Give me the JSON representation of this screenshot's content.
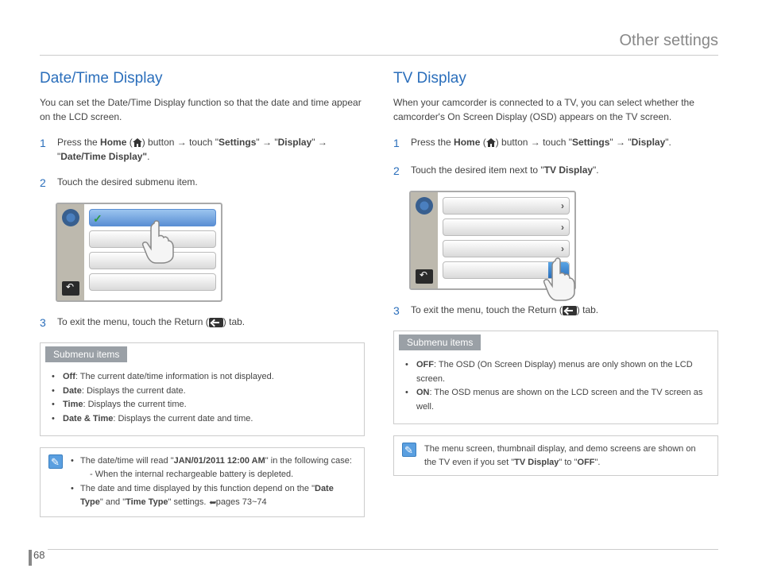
{
  "page_header": "Other settings",
  "page_number": "68",
  "left": {
    "title": "Date/Time Display",
    "intro": "You can set the Date/Time Display function so that the date and time appear on the LCD screen.",
    "step1_a": "Press the ",
    "step1_home": "Home",
    "step1_b": " (",
    "step1_c": ") button ",
    "arrow": "→",
    "step1_touch": " touch \"",
    "step1_settings": "Settings",
    "step1_q2": "\" ",
    "step1_q3": " \"",
    "step1_display": "Display",
    "step1_q4": "\" ",
    "step1_q5": " \"",
    "step1_dtd": "Date/Time Display\"",
    "step1_period": ".",
    "step2": "Touch the desired submenu item.",
    "step3_a": "To exit the menu, touch the Return (",
    "step3_b": ") tab.",
    "submenu_header": "Submenu items",
    "submenu": [
      {
        "label": "Off",
        "desc": ": The current date/time information is not displayed."
      },
      {
        "label": "Date",
        "desc": ": Displays the current date."
      },
      {
        "label": "Time",
        "desc": ": Displays the current time."
      },
      {
        "label": "Date & Time",
        "desc": ": Displays the current date and time."
      }
    ],
    "note1_a": "The date/time will read \"",
    "note1_bold": "JAN/01/2011 12:00 AM",
    "note1_b": "\" in the following case:",
    "note1_sub": "- When the internal rechargeable battery is depleted.",
    "note2_a": "The date and time displayed by this function depend on the \"",
    "note2_dt": "Date Type",
    "note2_b": "\" and \"",
    "note2_tt": "Time Type",
    "note2_c": "\" settings. ",
    "note2_pages": "pages 73~74"
  },
  "right": {
    "title": "TV Display",
    "intro": "When your camcorder is connected to a TV, you can select whether the camcorder's On Screen Display (OSD) appears on the TV screen.",
    "step1_a": "Press the ",
    "step1_home": "Home",
    "step1_b": " (",
    "step1_c": ") button ",
    "step1_touch": " touch \"",
    "step1_settings": "Settings",
    "step1_q2": "\" ",
    "step1_q3": " \"",
    "step1_display": "Display",
    "step1_q4": "\".",
    "step2_a": "Touch the desired item next to \"",
    "step2_bold": "TV Display",
    "step2_b": "\".",
    "step3_a": "To exit the menu, touch the Return (",
    "step3_b": ") tab.",
    "submenu_header": "Submenu items",
    "submenu": [
      {
        "label": "OFF",
        "desc": ": The OSD (On Screen Display) menus are only shown on the LCD screen."
      },
      {
        "label": "ON",
        "desc": ": The OSD menus are shown on the LCD screen and the TV screen as well."
      }
    ],
    "note_a": "The menu screen, thumbnail display, and demo screens are shown on the TV even if you set \"",
    "note_bold1": "TV Display",
    "note_b": "\" to \"",
    "note_bold2": "OFF",
    "note_c": "\"."
  }
}
